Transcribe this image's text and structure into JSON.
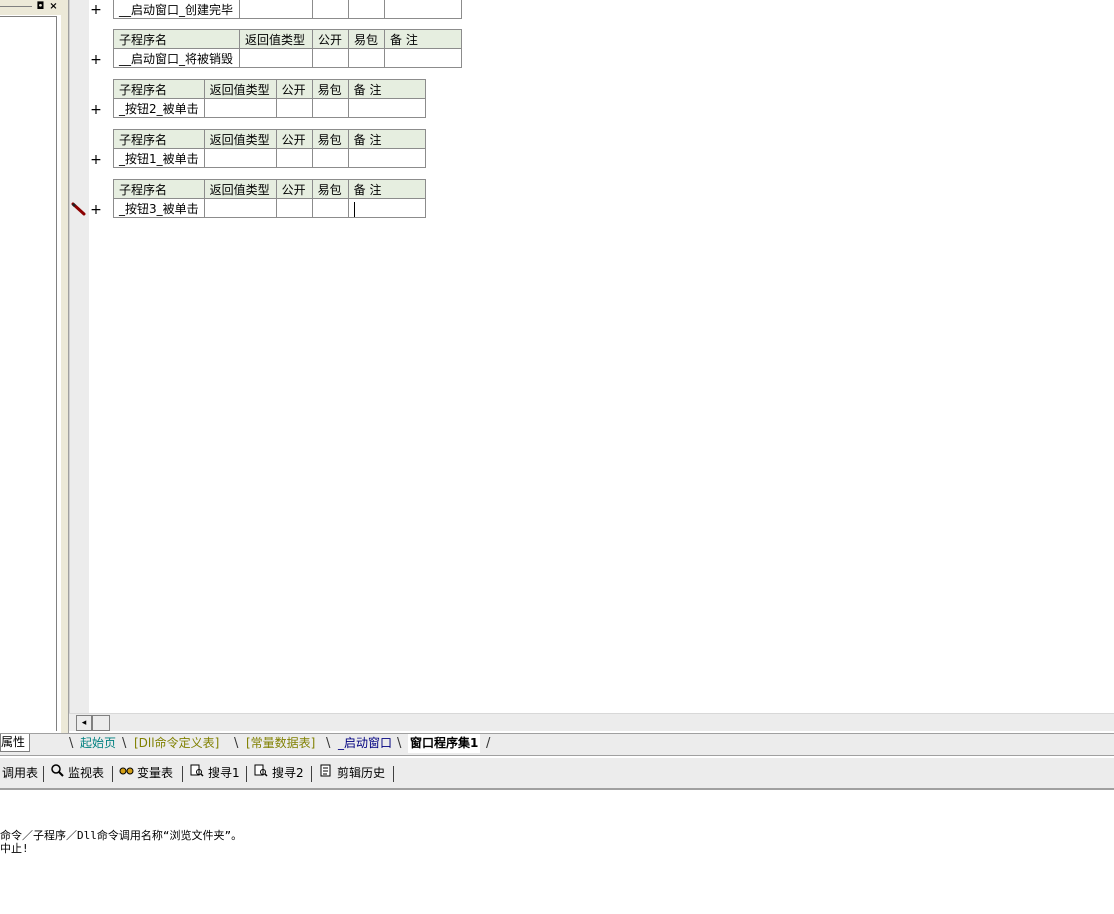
{
  "left_panel": {
    "tab_label": "属性",
    "btn_restore": "◘",
    "btn_close": "×"
  },
  "tables": [
    {
      "headers": [],
      "row": {
        "name": "__启动窗口_创建完毕",
        "return_type": "",
        "public": "",
        "easy_pack": "",
        "note": ""
      }
    },
    {
      "headers": [
        "子程序名",
        "返回值类型",
        "公开",
        "易包",
        "备 注"
      ],
      "row": {
        "name": "__启动窗口_将被销毁",
        "return_type": "",
        "public": "",
        "easy_pack": "",
        "note": ""
      }
    },
    {
      "headers": [
        "子程序名",
        "返回值类型",
        "公开",
        "易包",
        "备 注"
      ],
      "row": {
        "name": "_按钮2_被单击",
        "return_type": "",
        "public": "",
        "easy_pack": "",
        "note": ""
      }
    },
    {
      "headers": [
        "子程序名",
        "返回值类型",
        "公开",
        "易包",
        "备 注"
      ],
      "row": {
        "name": "_按钮1_被单击",
        "return_type": "",
        "public": "",
        "easy_pack": "",
        "note": ""
      }
    },
    {
      "headers": [
        "子程序名",
        "返回值类型",
        "公开",
        "易包",
        "备 注"
      ],
      "row": {
        "name": "_按钮3_被单击",
        "return_type": "",
        "public": "",
        "easy_pack": "",
        "note": ""
      }
    }
  ],
  "expand_symbol": "+",
  "scroll_left_arrow": "◂",
  "tabs": [
    {
      "label": "起始页",
      "color": "#008080",
      "active": false
    },
    {
      "label": "[Dll命令定义表]",
      "color": "#808000",
      "active": false
    },
    {
      "label": "[常量数据表]",
      "color": "#808000",
      "active": false
    },
    {
      "label": "_启动窗口",
      "color": "#000080",
      "active": false
    },
    {
      "label": "窗口程序集1",
      "color": "#000000",
      "active": true
    }
  ],
  "toolbar": {
    "items": [
      {
        "label": "调用表",
        "icon": ""
      },
      {
        "label": "监视表",
        "icon": "search-icon"
      },
      {
        "label": "变量表",
        "icon": "variables-icon"
      },
      {
        "label": "搜寻1",
        "icon": "find-icon"
      },
      {
        "label": "搜寻2",
        "icon": "find-icon"
      },
      {
        "label": "剪辑历史",
        "icon": "clipboard-icon"
      }
    ]
  },
  "output": {
    "lines": [
      "命令／子程序／Dll命令调用名称“浏览文件夹”。",
      "中止!"
    ]
  }
}
